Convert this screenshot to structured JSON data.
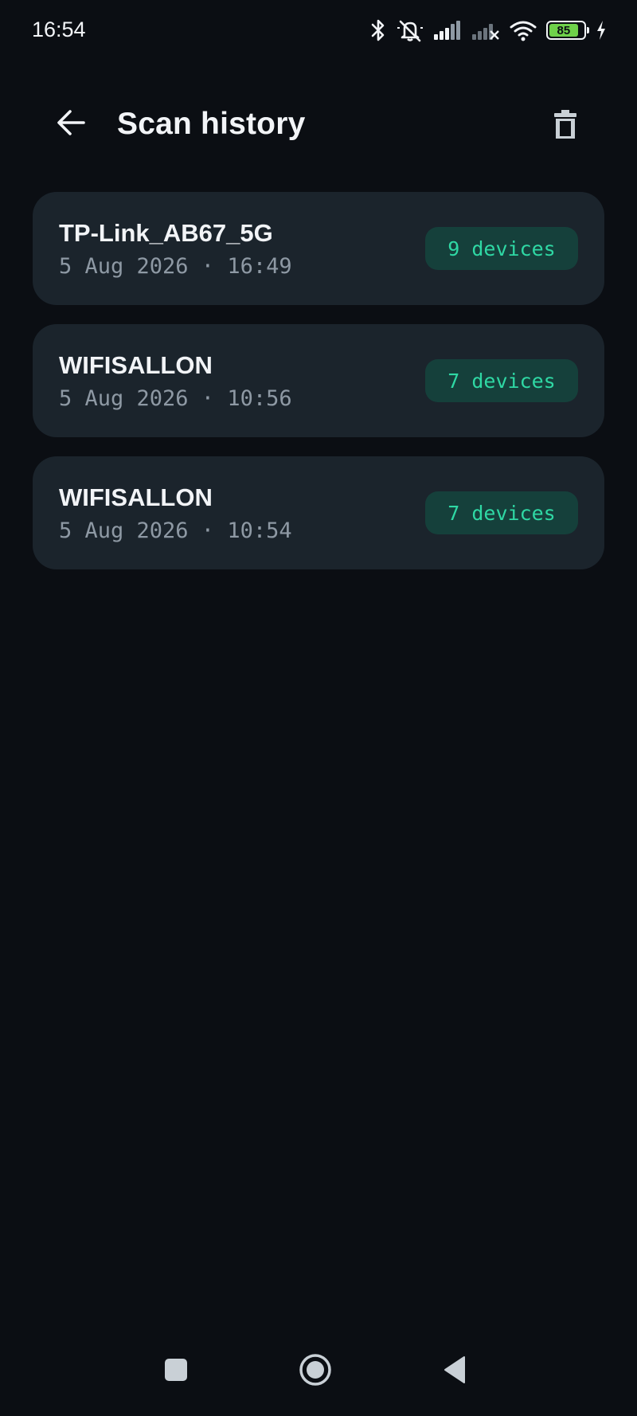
{
  "status_bar": {
    "time": "16:54",
    "battery_level": "85",
    "icons": [
      "bluetooth-icon",
      "mute-icon",
      "signal-icon",
      "signal-no-service-icon",
      "wifi-icon",
      "battery-icon",
      "charging-icon"
    ]
  },
  "app_bar": {
    "title": "Scan history",
    "back_icon": "arrow-left-icon",
    "delete_icon": "trash-icon"
  },
  "history": [
    {
      "ssid": "TP-Link_AB67_5G",
      "datetime": "5 Aug 2026 · 16:49",
      "devices": "9 devices"
    },
    {
      "ssid": "WIFISALLON",
      "datetime": "5 Aug 2026 · 10:56",
      "devices": "7 devices"
    },
    {
      "ssid": "WIFISALLON",
      "datetime": "5 Aug 2026 · 10:54",
      "devices": "7 devices"
    }
  ],
  "nav_bar": {
    "icons": [
      "recents-square-icon",
      "home-circle-icon",
      "back-triangle-icon"
    ]
  },
  "colors": {
    "background": "#0b0e13",
    "card": "#1b242c",
    "badge_bg": "#15403b",
    "accent": "#2fd8a4",
    "battery": "#6fd14a"
  }
}
